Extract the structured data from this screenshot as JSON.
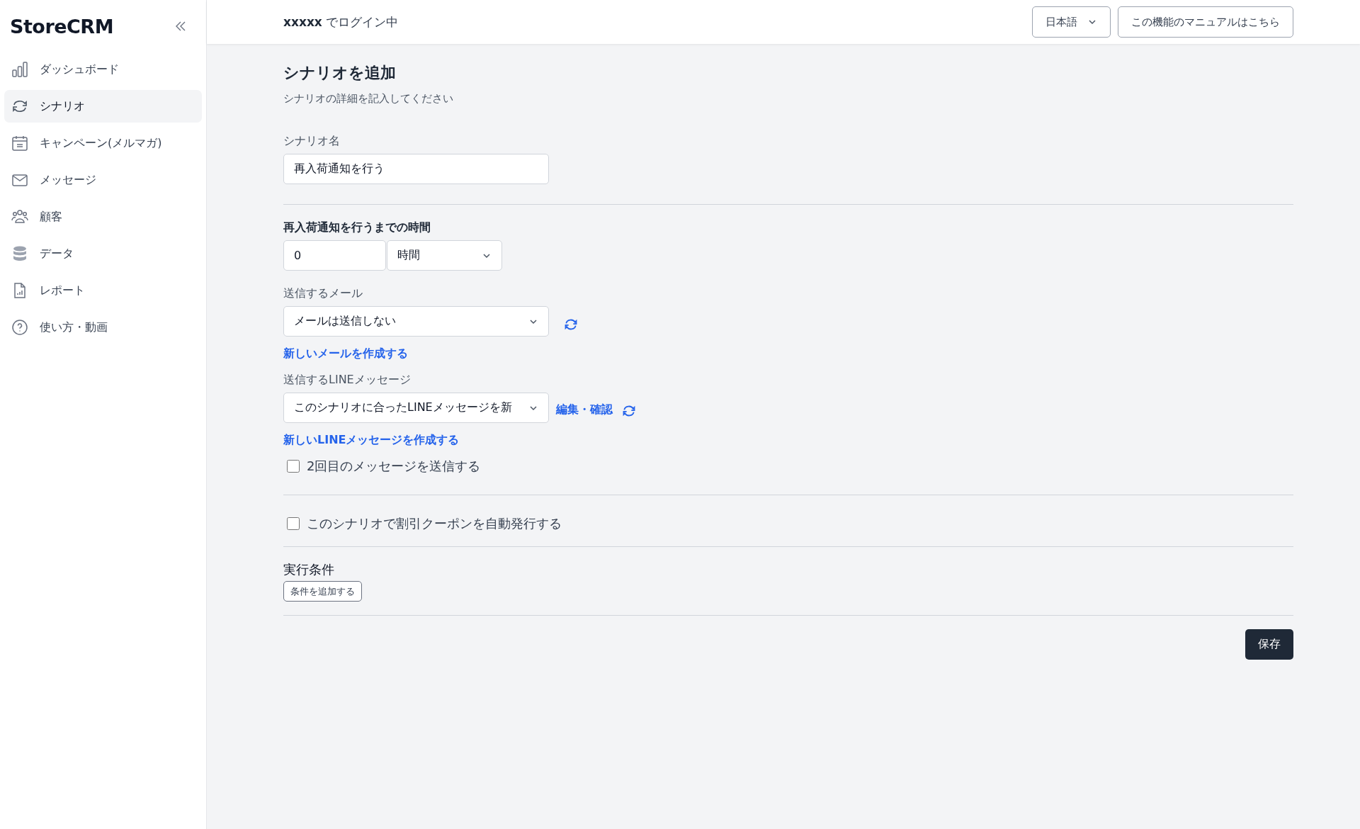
{
  "sidebar": {
    "logo": "StoreCRM",
    "items": [
      {
        "label": "ダッシュボード",
        "kind": "bars",
        "selected": false
      },
      {
        "label": "シナリオ",
        "kind": "cycle",
        "selected": true
      },
      {
        "label": "キャンペーン(メルマガ)",
        "kind": "calendar",
        "selected": false
      },
      {
        "label": "メッセージ",
        "kind": "mail",
        "selected": false
      },
      {
        "label": "顧客",
        "kind": "users",
        "selected": false
      },
      {
        "label": "データ",
        "kind": "database",
        "selected": false
      },
      {
        "label": "レポート",
        "kind": "report",
        "selected": false
      },
      {
        "label": "使い方・動画",
        "kind": "help",
        "selected": false
      }
    ]
  },
  "header": {
    "user": "xxxxx",
    "login_text": "でログイン中",
    "language": "日本語",
    "manual_button": "この機能のマニュアルはこちら"
  },
  "form": {
    "title": "シナリオを追加",
    "subtitle": "シナリオの詳細を記入してください",
    "name_label": "シナリオ名",
    "name_value": "再入荷通知を行う",
    "delay_label": "再入荷通知を行うまでの時間",
    "delay_value": "0",
    "delay_unit": "時間",
    "mail_label": "送信するメール",
    "mail_value": "メールは送信しない",
    "mail_link": "新しいメールを作成する",
    "line_label": "送信するLINEメッセージ",
    "line_value": "このシナリオに合ったLINEメッセージを新",
    "line_edit_link": "編集・確認",
    "line_link": "新しいLINEメッセージを作成する",
    "second_message": {
      "label": "2回目のメッセージを送信する",
      "checked": false
    },
    "coupon": {
      "label": "このシナリオで割引クーポンを自動発行する",
      "checked": false
    },
    "conditions_label": "実行条件",
    "add_condition_button": "条件を追加する",
    "save_button": "保存"
  }
}
